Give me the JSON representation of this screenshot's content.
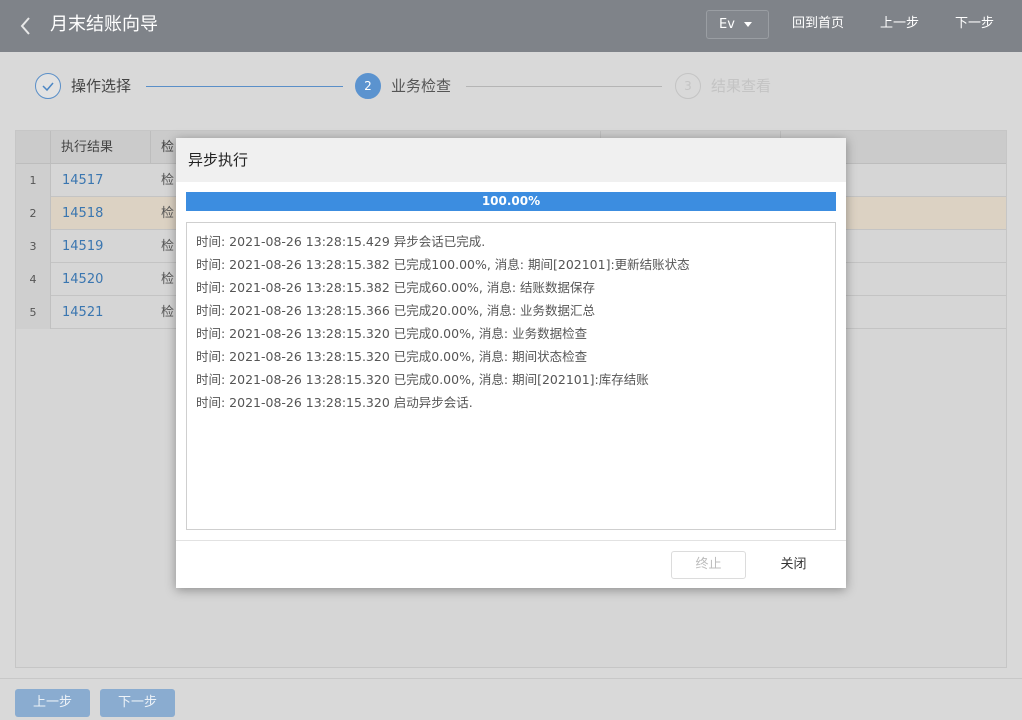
{
  "header": {
    "title": "月末结账向导",
    "user_label": "Ev",
    "home_label": "回到首页",
    "prev_label": "上一步",
    "next_label": "下一步"
  },
  "steps": [
    {
      "number": "1",
      "label": "操作选择",
      "status": "done"
    },
    {
      "number": "2",
      "label": "业务检查",
      "status": "active"
    },
    {
      "number": "3",
      "label": "结果查看",
      "status": "pending"
    }
  ],
  "table": {
    "columns": [
      "执行结果",
      "检"
    ],
    "rows": [
      {
        "index": "1",
        "result": "14517",
        "check": "检"
      },
      {
        "index": "2",
        "result": "14518",
        "check": "检"
      },
      {
        "index": "3",
        "result": "14519",
        "check": "检"
      },
      {
        "index": "4",
        "result": "14520",
        "check": "检"
      },
      {
        "index": "5",
        "result": "14521",
        "check": "检"
      }
    ],
    "selected_row": 2
  },
  "bottom": {
    "prev_label": "上一步",
    "next_label": "下一步"
  },
  "modal": {
    "title": "异步执行",
    "progress_percent": 100,
    "progress_text": "100.00%",
    "log": [
      "时间: 2021-08-26 13:28:15.429 异步会话已完成.",
      "时间: 2021-08-26 13:28:15.382 已完成100.00%, 消息: 期间[202101]:更新结账状态",
      "时间: 2021-08-26 13:28:15.382 已完成60.00%, 消息: 结账数据保存",
      "时间: 2021-08-26 13:28:15.366 已完成20.00%, 消息: 业务数据汇总",
      "时间: 2021-08-26 13:28:15.320 已完成0.00%, 消息: 业务数据检查",
      "时间: 2021-08-26 13:28:15.320 已完成0.00%, 消息: 期间状态检查",
      "时间: 2021-08-26 13:28:15.320 已完成0.00%, 消息: 期间[202101]:库存结账",
      "时间: 2021-08-26 13:28:15.320 启动异步会话."
    ],
    "terminate_label": "终止",
    "close_label": "关闭"
  },
  "colors": {
    "header_bg": "#7f8389",
    "accent": "#3c8de0",
    "link": "#3a76b0",
    "selected_row": "#dcd2c3"
  },
  "icons": [
    "back-icon",
    "caret-down-icon",
    "check-icon"
  ]
}
